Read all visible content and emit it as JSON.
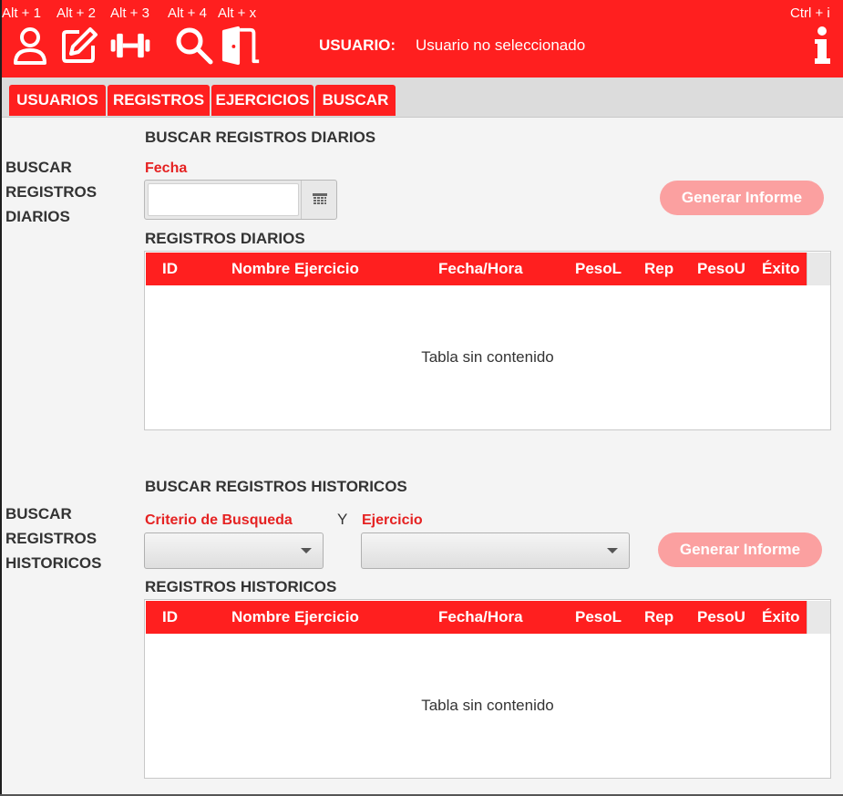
{
  "shortcuts": [
    "Alt + 1",
    "Alt + 2",
    "Alt + 3",
    "Alt + 4",
    "Alt + x",
    "Ctrl + i"
  ],
  "header": {
    "user_label": "USUARIO:",
    "user_value": "Usuario no seleccionado",
    "colors": {
      "bar": "#ff1f1f",
      "text": "#ffffff"
    },
    "icons": [
      "user-icon",
      "edit-icon",
      "dumbbell-icon",
      "search-icon",
      "exit-door-icon",
      "info-icon"
    ]
  },
  "tabs": [
    {
      "label": "USUARIOS"
    },
    {
      "label": "REGISTROS"
    },
    {
      "label": "EJERCICIOS"
    },
    {
      "label": "BUSCAR"
    }
  ],
  "daily": {
    "side_label": [
      "BUSCAR",
      "REGISTROS",
      "DIARIOS"
    ],
    "title": "BUSCAR REGISTROS DIARIOS",
    "date_label": "Fecha",
    "date_value": "",
    "report_button": "Generar Informe",
    "table_title": "REGISTROS DIARIOS",
    "columns": [
      "ID",
      "Nombre Ejercicio",
      "Fecha/Hora",
      "PesoL",
      "Rep",
      "PesoU",
      "Éxito"
    ],
    "empty_message": "Tabla sin contenido"
  },
  "historic": {
    "side_label": [
      "BUSCAR",
      "REGISTROS",
      "HISTORICOS"
    ],
    "title": "BUSCAR REGISTROS HISTORICOS",
    "criteria_label": "Criterio de Busqueda",
    "conjunction": "Y",
    "exercise_label": "Ejercicio",
    "criteria_value": "",
    "exercise_value": "",
    "report_button": "Generar Informe",
    "table_title": "REGISTROS HISTORICOS",
    "columns": [
      "ID",
      "Nombre Ejercicio",
      "Fecha/Hora",
      "PesoL",
      "Rep",
      "PesoU",
      "Éxito"
    ],
    "empty_message": "Tabla sin contenido"
  },
  "colors": {
    "accent": "#ff1f1f",
    "label_red": "#e52222",
    "button_disabled": "#fba0a0"
  }
}
